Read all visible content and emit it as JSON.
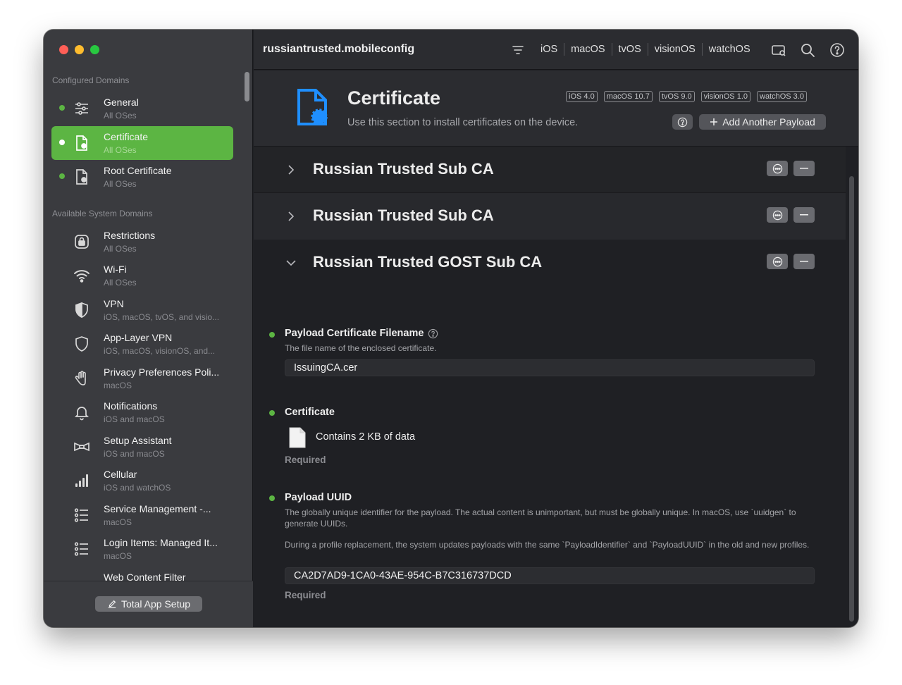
{
  "window": {
    "file_name": "russiantrusted.mobileconfig"
  },
  "toolbar": {
    "platforms": [
      "iOS",
      "macOS",
      "tvOS",
      "visionOS",
      "watchOS"
    ],
    "icons": [
      "filter-icon",
      "preview-icon",
      "search-icon",
      "help-icon"
    ]
  },
  "sidebar": {
    "configured_label": "Configured Domains",
    "available_label": "Available System Domains",
    "configured": [
      {
        "title": "General",
        "subtitle": "All OSes",
        "icon": "sliders-icon"
      },
      {
        "title": "Certificate",
        "subtitle": "All OSes",
        "icon": "certificate-icon",
        "active": true
      },
      {
        "title": "Root Certificate",
        "subtitle": "All OSes",
        "icon": "root-certificate-icon"
      }
    ],
    "available": [
      {
        "title": "Restrictions",
        "subtitle": "All OSes",
        "icon": "lock-icon"
      },
      {
        "title": "Wi-Fi",
        "subtitle": "All OSes",
        "icon": "wifi-icon"
      },
      {
        "title": "VPN",
        "subtitle": "iOS, macOS, tvOS, and visio...",
        "icon": "shield-half-icon"
      },
      {
        "title": "App-Layer VPN",
        "subtitle": "iOS, macOS, visionOS, and...",
        "icon": "shield-icon"
      },
      {
        "title": "Privacy Preferences Poli...",
        "subtitle": "macOS",
        "icon": "hand-icon"
      },
      {
        "title": "Notifications",
        "subtitle": "iOS and macOS",
        "icon": "bell-icon"
      },
      {
        "title": "Setup Assistant",
        "subtitle": "iOS and macOS",
        "icon": "bowtie-icon"
      },
      {
        "title": "Cellular",
        "subtitle": "iOS and watchOS",
        "icon": "cellular-bars-icon"
      },
      {
        "title": "Service Management -...",
        "subtitle": "macOS",
        "icon": "list-icon"
      },
      {
        "title": "Login Items: Managed It...",
        "subtitle": "macOS",
        "icon": "list-icon"
      },
      {
        "title": "Web Content Filter",
        "subtitle": "",
        "icon": "filter-lines-icon"
      }
    ],
    "footer_button": "Total App Setup"
  },
  "header": {
    "title": "Certificate",
    "description": "Use this section to install certificates on the device.",
    "badges": [
      "iOS  4.0",
      "macOS  10.7",
      "tvOS  9.0",
      "visionOS  1.0",
      "watchOS  3.0"
    ],
    "add_button": "Add Another Payload"
  },
  "payloads": [
    {
      "title": "Russian Trusted Sub CA",
      "expanded": false
    },
    {
      "title": "Russian Trusted Sub CA",
      "expanded": false
    },
    {
      "title": "Russian Trusted GOST Sub CA",
      "expanded": true
    }
  ],
  "fields": {
    "filename": {
      "label": "Payload Certificate Filename",
      "description": "The file name of the enclosed certificate.",
      "value": "IssuingCA.cer"
    },
    "certificate": {
      "label": "Certificate",
      "file_text": "Contains 2 KB of data",
      "required": "Required"
    },
    "uuid": {
      "label": "Payload UUID",
      "description1": "The globally unique identifier for the payload. The actual content is unimportant, but must be globally unique. In macOS, use `uuidgen` to generate UUIDs.",
      "description2": "During a profile replacement, the system updates payloads with the same `PayloadIdentifier` and `PayloadUUID` in the old and new profiles.",
      "value": "CA2D7AD9-1CA0-43AE-954C-B7C316737DCD",
      "required": "Required"
    }
  },
  "colors": {
    "accent_green": "#5cb543",
    "certificate_blue": "#1f8fff",
    "sidebar_bg": "#3a3b3f",
    "content_bg": "#1f2024"
  }
}
